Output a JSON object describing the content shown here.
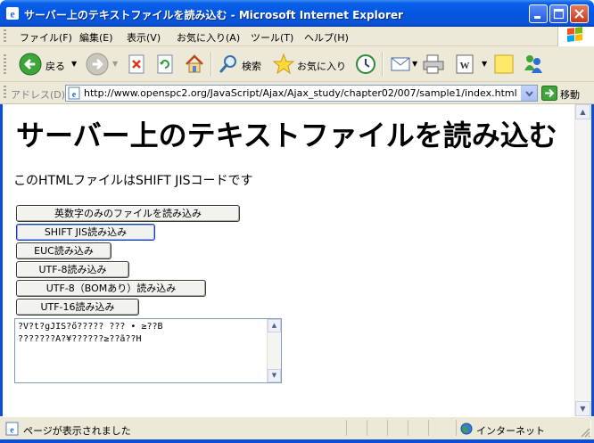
{
  "window": {
    "title": "サーバー上のテキストファイルを読み込む - Microsoft Internet Explorer"
  },
  "menu": {
    "items": [
      "ファイル(F)",
      "編集(E)",
      "表示(V)",
      "お気に入り(A)",
      "ツール(T)",
      "ヘルプ(H)"
    ]
  },
  "toolbar": {
    "back_label": "戻る",
    "search_label": "検索",
    "favorites_label": "お気に入り"
  },
  "address": {
    "label": "アドレス(D)",
    "url": "http://www.openspc2.org/JavaScript/Ajax/Ajax_study/chapter02/007/sample1/index.html",
    "go_label": "移動"
  },
  "page": {
    "heading": "サーバー上のテキストファイルを読み込む",
    "description": "このHTMLファイルはSHIFT JISコードです",
    "buttons": [
      "英数字のみのファイルを読み込み",
      "SHIFT JIS読み込み",
      "EUC読み込み",
      "UTF-8読み込み",
      "UTF-8（BOMあり）読み込み",
      "UTF-16読み込み"
    ],
    "output_text": "?V?t?gJIS?ő????? ??? • ≥??B\n???????A?¥??????≥??ã??H"
  },
  "status": {
    "message": "ページが表示されました",
    "zone": "インターネット"
  },
  "colors": {
    "titlebar": "#0a5ee8",
    "chrome": "#ece9d8",
    "link_blue": "#1c3f9b"
  }
}
